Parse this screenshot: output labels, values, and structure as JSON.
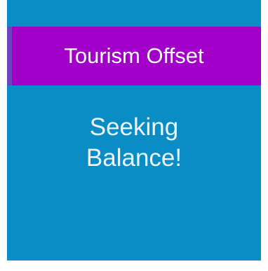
{
  "tile": {
    "title": "Tourism Offset",
    "body_lines": [
      "Seeking",
      "Balance!"
    ]
  },
  "colors": {
    "tile_background": "#0a8cc4",
    "title_bar": "#a200c8",
    "title_bar_edge": "#6e43be",
    "text": "#ffffff"
  }
}
